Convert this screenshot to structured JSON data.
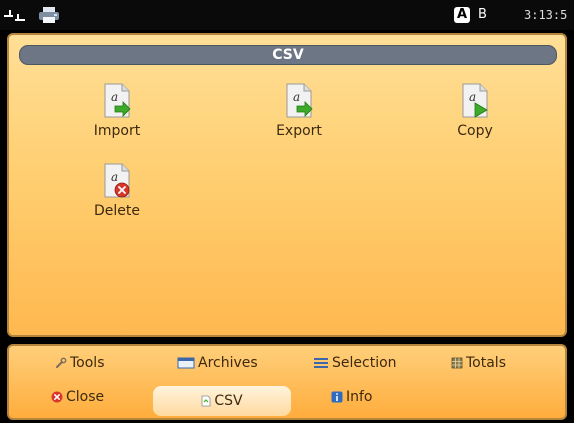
{
  "status": {
    "usb_icon": "usb-icon",
    "printer_icon": "printer-icon",
    "badge_a": "A",
    "badge_b": "B",
    "time": "3:13:5"
  },
  "panel": {
    "title": "CSV",
    "actions": [
      {
        "label": "Import",
        "icon": "import-doc-icon"
      },
      {
        "label": "Export",
        "icon": "export-doc-icon"
      },
      {
        "label": "Copy",
        "icon": "copy-doc-icon"
      },
      {
        "label": "Delete",
        "icon": "delete-doc-icon"
      }
    ]
  },
  "menu": {
    "row1": [
      {
        "label": "Tools",
        "icon": "wrench-icon"
      },
      {
        "label": "Archives",
        "icon": "archive-icon"
      },
      {
        "label": "Selection",
        "icon": "selection-icon"
      },
      {
        "label": "Totals",
        "icon": "totals-icon"
      }
    ],
    "row2": [
      {
        "label": "Close",
        "icon": "close-icon"
      },
      {
        "label": "CSV",
        "icon": "csv-icon",
        "active": true
      },
      {
        "label": "Info",
        "icon": "info-icon"
      }
    ]
  },
  "colors": {
    "panel_top": "#ffdf97",
    "panel_bottom": "#ffb84f",
    "title_bar": "#6d7684",
    "green_arrow": "#3daa2a",
    "delete_red": "#d9362b"
  }
}
